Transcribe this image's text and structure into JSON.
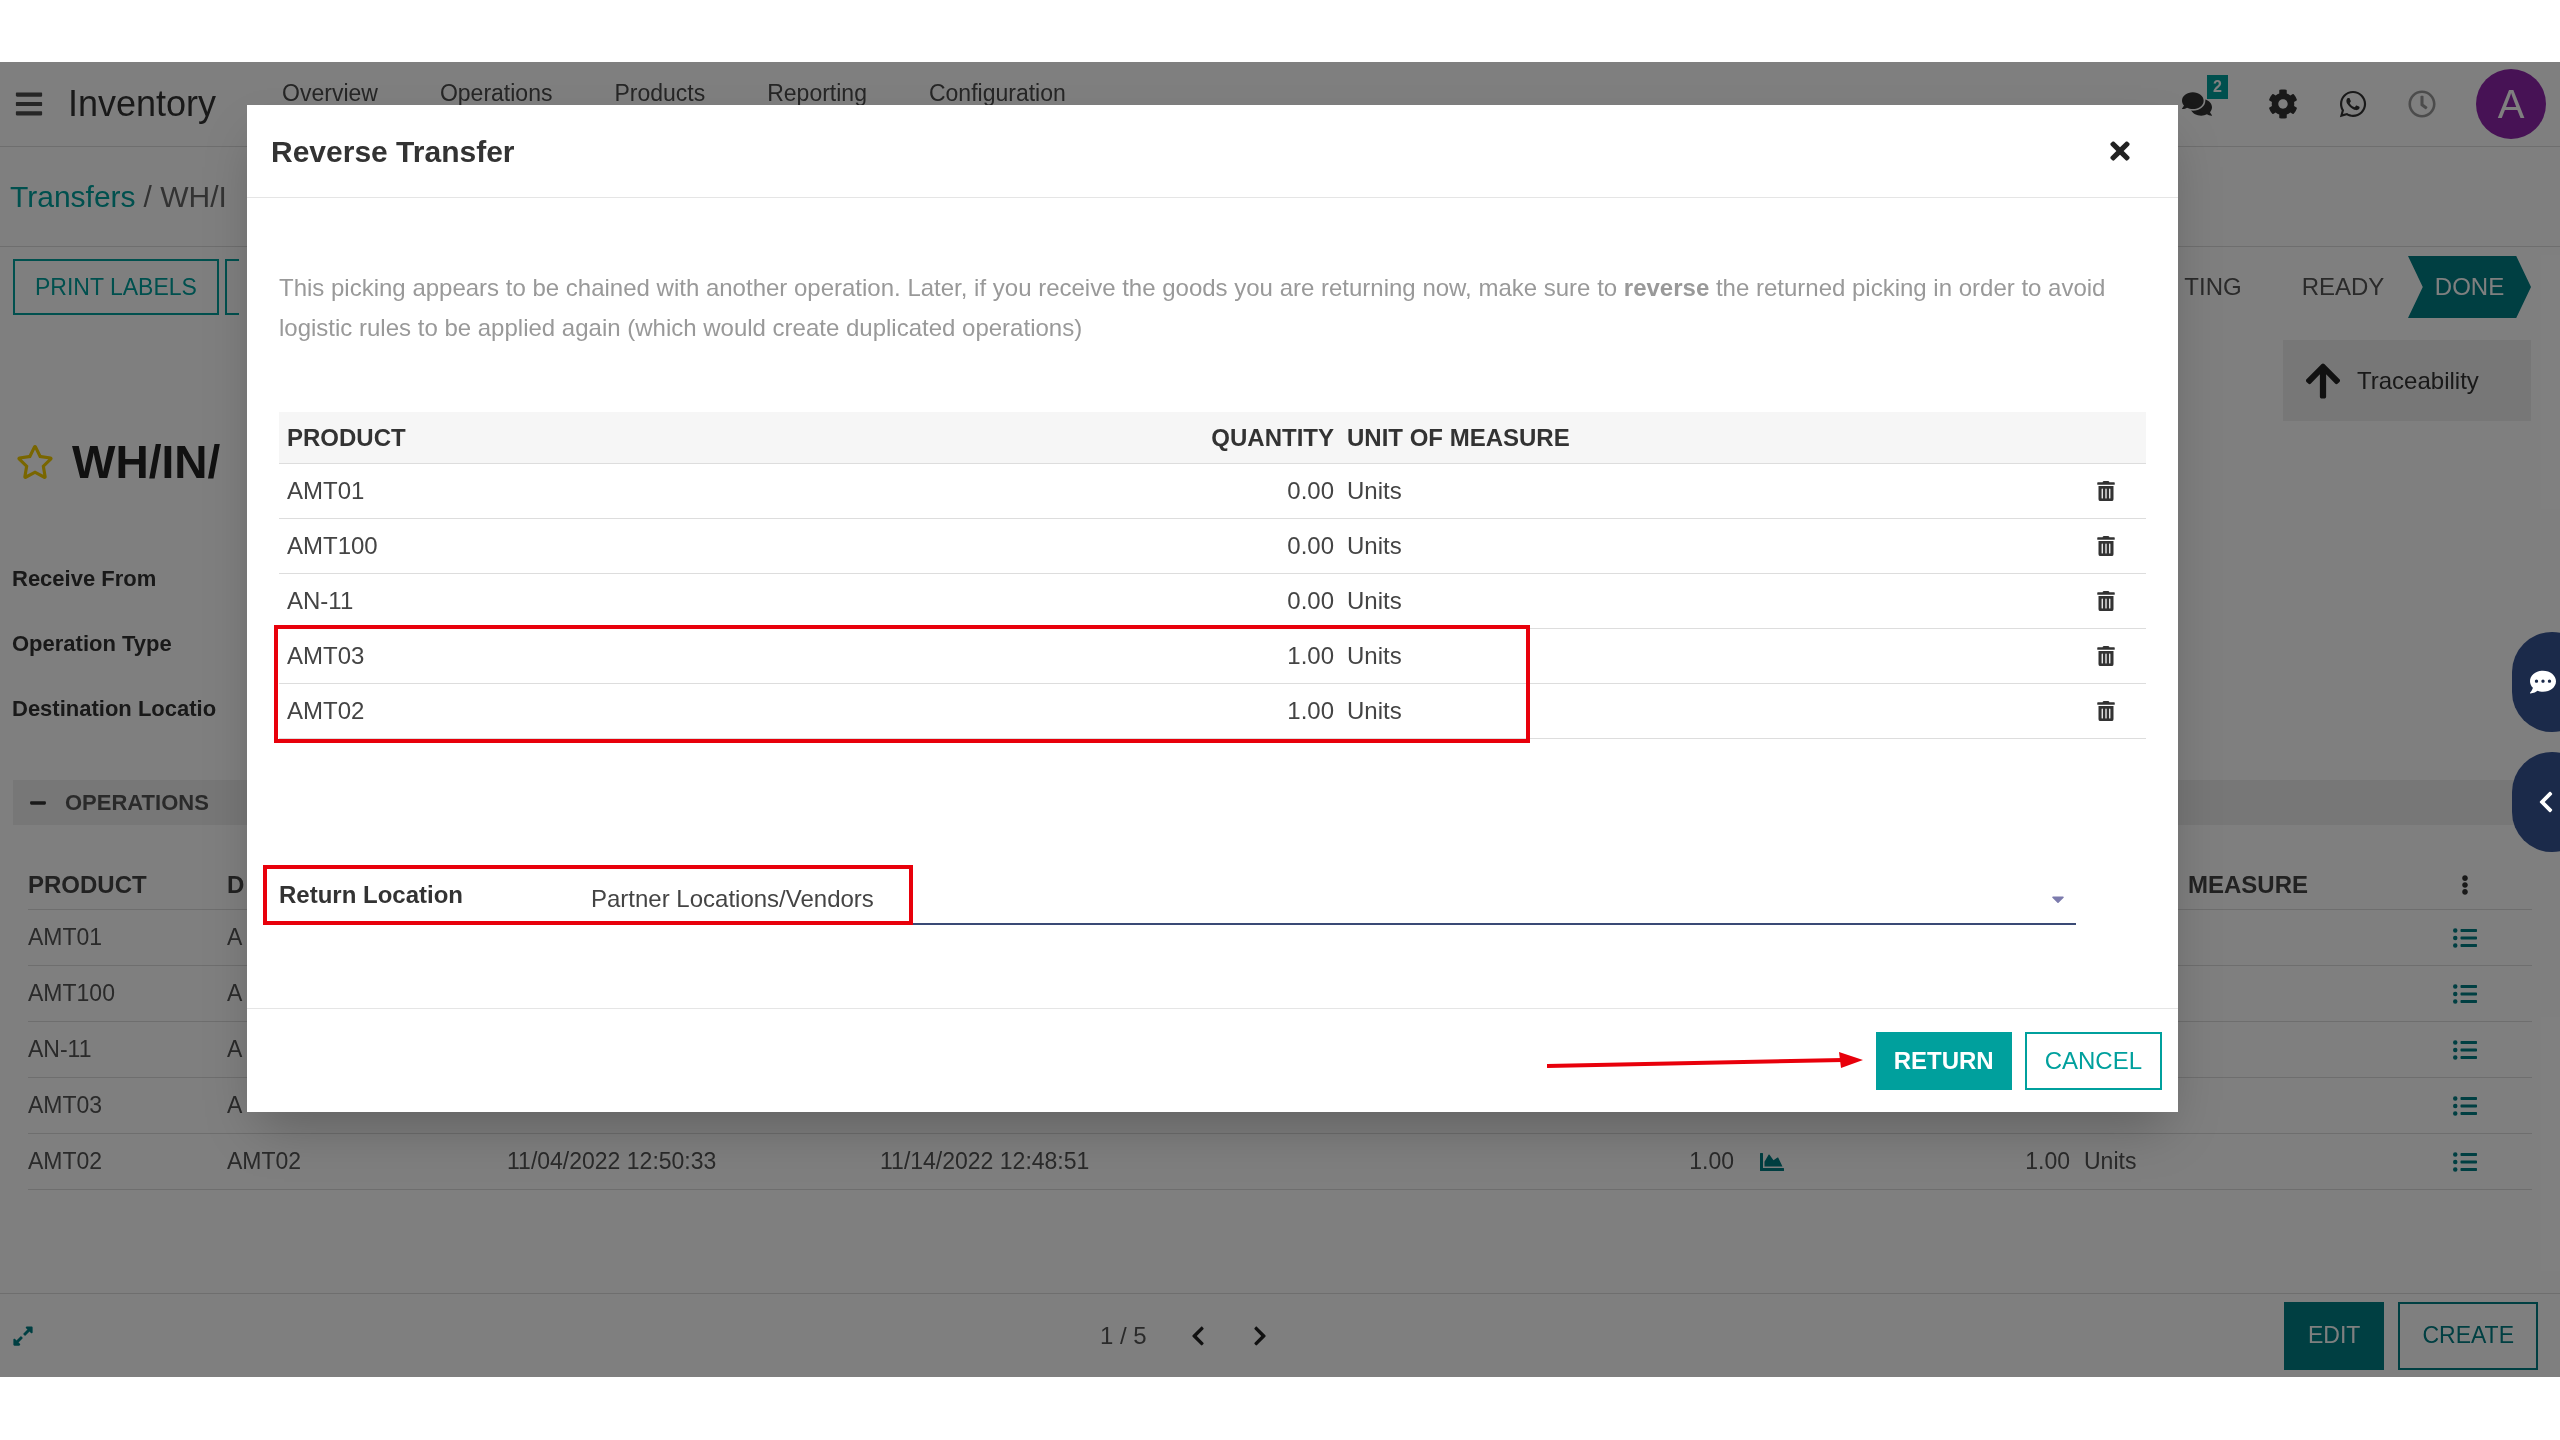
{
  "navbar": {
    "app_name": "Inventory",
    "menu": [
      "Overview",
      "Operations",
      "Products",
      "Reporting",
      "Configuration"
    ],
    "message_count": "2",
    "avatar": "A"
  },
  "breadcrumb": {
    "link": "Transfers",
    "current": "/ WH/I"
  },
  "actions": [
    "PRINT LABELS"
  ],
  "status_steps": [
    {
      "label": "TING",
      "selected": false
    },
    {
      "label": "READY",
      "selected": false
    },
    {
      "label": "DONE",
      "selected": true
    }
  ],
  "smart_button": "Traceability",
  "record": {
    "title": "WH/IN/",
    "starred": false,
    "field_labels": [
      "Receive From",
      "Operation Type",
      "Destination Locatio"
    ]
  },
  "operations": {
    "section": "OPERATIONS",
    "expanded": true,
    "columns": [
      "PRODUCT",
      "D",
      "MEASURE"
    ],
    "rows": [
      {
        "cells": [
          "AMT01",
          "A"
        ]
      },
      {
        "cells": [
          "AMT100",
          "A"
        ]
      },
      {
        "cells": [
          "AN-11",
          "A"
        ]
      },
      {
        "cells": [
          "AMT03",
          "A"
        ]
      },
      {
        "cells": [
          "AMT02",
          "AMT02",
          "11/04/2022 12:50:33",
          "11/14/2022 12:48:51",
          "1.00",
          "1.00",
          "Units"
        ]
      }
    ]
  },
  "pager": {
    "position": "1 / 5"
  },
  "form_buttons": [
    {
      "label": "EDIT",
      "kind": "primary"
    },
    {
      "label": "CREATE",
      "kind": "secondary"
    }
  ],
  "dialog": {
    "title": "Reverse Transfer",
    "message": "This picking appears to be chained with another operation. Later, if you receive the goods you are returning now, make sure to **reverse** the returned picking in order to avoid logistic rules to be applied again (which would create duplicated operations)",
    "columns": [
      "PRODUCT",
      "QUANTITY",
      "UNIT OF MEASURE"
    ],
    "rows": [
      {
        "product": "AMT01",
        "quantity": "0.00",
        "uom": "Units",
        "highlighted": false
      },
      {
        "product": "AMT100",
        "quantity": "0.00",
        "uom": "Units",
        "highlighted": false
      },
      {
        "product": "AN-11",
        "quantity": "0.00",
        "uom": "Units",
        "highlighted": false
      },
      {
        "product": "AMT03",
        "quantity": "1.00",
        "uom": "Units",
        "highlighted": true
      },
      {
        "product": "AMT02",
        "quantity": "1.00",
        "uom": "Units",
        "highlighted": true
      }
    ],
    "return_location": {
      "label": "Return Location",
      "value": "Partner Locations/Vendors",
      "highlighted": true
    },
    "buttons": [
      {
        "label": "RETURN",
        "kind": "primary"
      },
      {
        "label": "CANCEL",
        "kind": "secondary"
      }
    ]
  }
}
